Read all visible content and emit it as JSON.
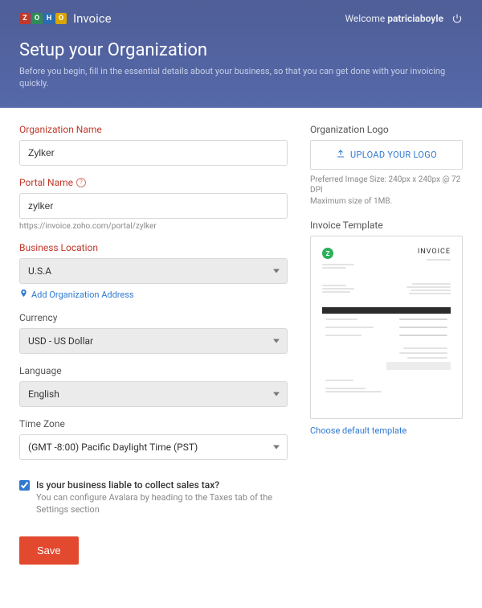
{
  "brand": {
    "z": "Z",
    "o": "O",
    "h": "H",
    "o2": "O",
    "product": "Invoice"
  },
  "welcome": {
    "prefix": "Welcome",
    "user": "patriciaboyle"
  },
  "title": "Setup your Organization",
  "subtitle": "Before you begin, fill in the essential details about your business, so that you can get done with your invoicing quickly.",
  "form": {
    "orgName": {
      "label": "Organization Name",
      "value": "Zylker"
    },
    "portalName": {
      "label": "Portal Name",
      "value": "zylker",
      "hint": "https://invoice.zoho.com/portal/zylker"
    },
    "location": {
      "label": "Business Location",
      "value": "U.S.A",
      "addLink": "Add Organization Address"
    },
    "currency": {
      "label": "Currency",
      "value": "USD - US Dollar"
    },
    "language": {
      "label": "Language",
      "value": "English"
    },
    "timezone": {
      "label": "Time Zone",
      "value": "(GMT -8:00) Pacific Daylight Time (PST)"
    },
    "tax": {
      "question": "Is your business liable to collect sales tax?",
      "help": "You can configure Avalara by heading to the Taxes tab of the Settings section"
    },
    "save": "Save"
  },
  "right": {
    "logoLabel": "Organization Logo",
    "uploadLabel": "UPLOAD YOUR LOGO",
    "logoHint1": "Preferred Image Size: 240px x 240px @ 72 DPI",
    "logoHint2": "Maximum size of 1MB.",
    "tplLabel": "Invoice Template",
    "tplInvoiceWord": "INVOICE",
    "tplZ": "Z",
    "chooseTpl": "Choose default template"
  }
}
